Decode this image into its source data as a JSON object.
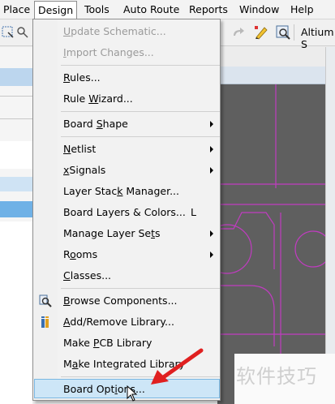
{
  "menubar": {
    "items": [
      {
        "label": "Place"
      },
      {
        "label": "Design",
        "active": true
      },
      {
        "label": "Tools"
      },
      {
        "label": "Auto Route"
      },
      {
        "label": "Reports"
      },
      {
        "label": "Window"
      },
      {
        "label": "Help"
      }
    ]
  },
  "toolbar": {
    "app_label": "Altium S"
  },
  "menu": {
    "items": [
      {
        "pre": "",
        "u": "U",
        "post": "pdate Schematic...",
        "disabled": true
      },
      {
        "pre": "",
        "u": "I",
        "post": "mport Changes...",
        "disabled": true
      },
      {
        "pre": "",
        "u": "R",
        "post": "ules..."
      },
      {
        "pre": "Rule ",
        "u": "W",
        "post": "izard..."
      },
      {
        "pre": "Board ",
        "u": "S",
        "post": "hape",
        "submenu": true
      },
      {
        "pre": "",
        "u": "N",
        "post": "etlist",
        "submenu": true
      },
      {
        "pre": "",
        "u": "x",
        "post": "Signals",
        "submenu": true
      },
      {
        "pre": "Layer Stac",
        "u": "k",
        "post": " Manager..."
      },
      {
        "pre": "Board Layers & Colors...",
        "u": "",
        "post": "",
        "shortcut": "L"
      },
      {
        "pre": "Manage Layer Se",
        "u": "t",
        "post": "s",
        "submenu": true
      },
      {
        "pre": "R",
        "u": "o",
        "post": "oms",
        "submenu": true
      },
      {
        "pre": "",
        "u": "C",
        "post": "lasses..."
      },
      {
        "pre": "",
        "u": "B",
        "post": "rowse Components...",
        "icon": "browse-components-icon"
      },
      {
        "pre": "",
        "u": "A",
        "post": "dd/Remove Library...",
        "icon": "library-icon"
      },
      {
        "pre": "Make ",
        "u": "P",
        "post": "CB Library"
      },
      {
        "pre": "M",
        "u": "a",
        "post": "ke Integrated Library"
      },
      {
        "pre": "Board Opt",
        "u": "i",
        "post": "ons...",
        "highlight": true
      }
    ]
  },
  "watermark": "软件技巧",
  "colors": {
    "accent": "#cde6f7",
    "canvas": "#5f5f5f",
    "pcb_line": "#c03cc0",
    "arrow": "#e02020"
  }
}
